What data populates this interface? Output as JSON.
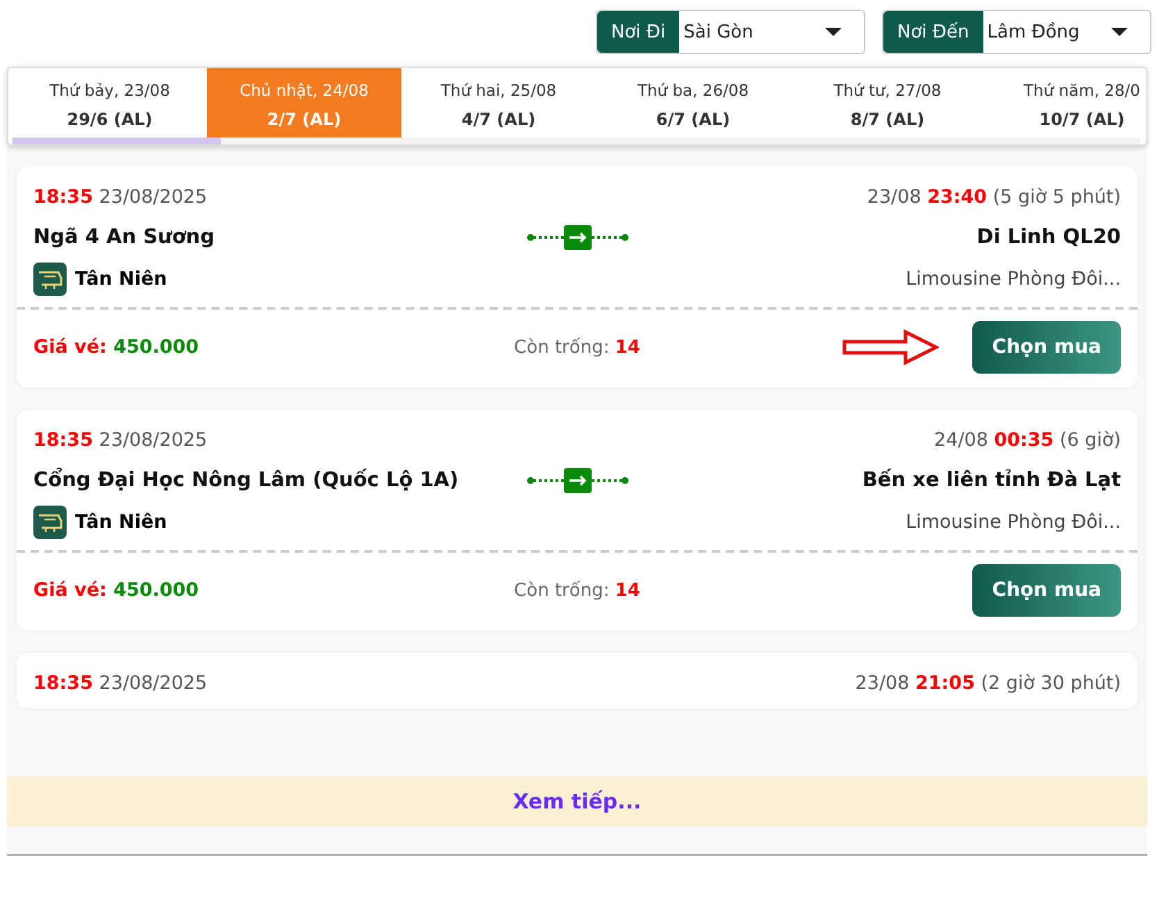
{
  "filters": [
    {
      "label": "Nơi Đi",
      "value": "Sài Gòn"
    },
    {
      "label": "Nơi Đến",
      "value": "Lâm Đồng"
    }
  ],
  "date_tabs": [
    {
      "day": "Thứ bảy, 23/08",
      "lunar": "29/6 (AL)",
      "selected": false
    },
    {
      "day": "Chủ nhật, 24/08",
      "lunar": "2/7 (AL)",
      "selected": true
    },
    {
      "day": "Thứ hai, 25/08",
      "lunar": "4/7 (AL)",
      "selected": false
    },
    {
      "day": "Thứ ba, 26/08",
      "lunar": "6/7 (AL)",
      "selected": false
    },
    {
      "day": "Thứ tư, 27/08",
      "lunar": "8/7 (AL)",
      "selected": false
    },
    {
      "day": "Thứ năm, 28/0",
      "lunar": "10/7 (AL)",
      "selected": false
    }
  ],
  "trips": [
    {
      "depart_time": "18:35",
      "depart_date": "23/08/2025",
      "arrive_date": "23/08",
      "arrive_time": "23:40",
      "duration": "(5 giờ 5 phút)",
      "from": "Ngã 4 An Sương",
      "to": "Di Linh QL20",
      "operator": "Tân Niên",
      "vehicle": "Limousine Phòng Đôi...",
      "price_label": "Giá vé:",
      "price": "450.000",
      "seats_label": "Còn trống:",
      "seats": "14",
      "button": "Chọn mua",
      "highlighted": true
    },
    {
      "depart_time": "18:35",
      "depart_date": "23/08/2025",
      "arrive_date": "24/08",
      "arrive_time": "00:35",
      "duration": "(6 giờ)",
      "from": "Cổng Đại Học Nông Lâm (Quốc Lộ 1A)",
      "to": "Bến xe liên tỉnh Đà Lạt",
      "operator": "Tân Niên",
      "vehicle": "Limousine Phòng Đôi...",
      "price_label": "Giá vé:",
      "price": "450.000",
      "seats_label": "Còn trống:",
      "seats": "14",
      "button": "Chọn mua",
      "highlighted": false
    },
    {
      "depart_time": "18:35",
      "depart_date": "23/08/2025",
      "arrive_date": "23/08",
      "arrive_time": "21:05",
      "duration": "(2 giờ 30 phút)"
    }
  ],
  "load_more": "Xem tiếp..."
}
